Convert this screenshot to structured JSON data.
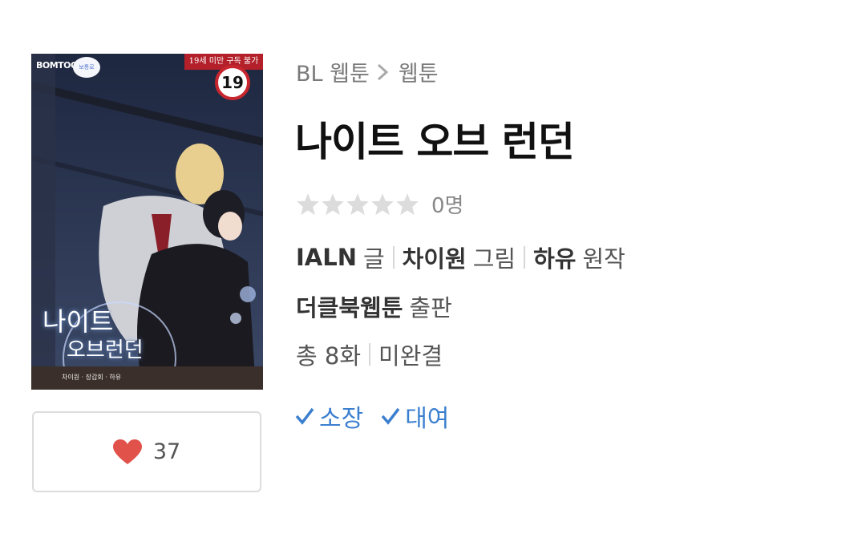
{
  "cover": {
    "age_banner": "19세 미만 구독 불가",
    "age_badge": "19",
    "logo": "BOMTOON",
    "bubble": "보통로",
    "title_line1": "나이트",
    "title_line2": "오브런던",
    "credits": "차이원 · 장갑회 · 하유"
  },
  "like": {
    "count": "37"
  },
  "breadcrumb": {
    "parent": "BL 웹툰",
    "current": "웹툰"
  },
  "title": "나이트 오브 런던",
  "rating": {
    "count": "0명"
  },
  "authors": {
    "writer": "IALN",
    "writer_role": "글",
    "artist": "차이원",
    "artist_role": "그림",
    "original": "하유",
    "original_role": "원작"
  },
  "publisher": {
    "name": "더클북웹툰",
    "role": "출판"
  },
  "episodes": {
    "total": "총 8화",
    "status": "미완결"
  },
  "actions": {
    "own": "소장",
    "rent": "대여"
  },
  "colors": {
    "accent": "#3b7fcf",
    "heart": "#e0524a",
    "star_empty": "#dcdcdc"
  }
}
